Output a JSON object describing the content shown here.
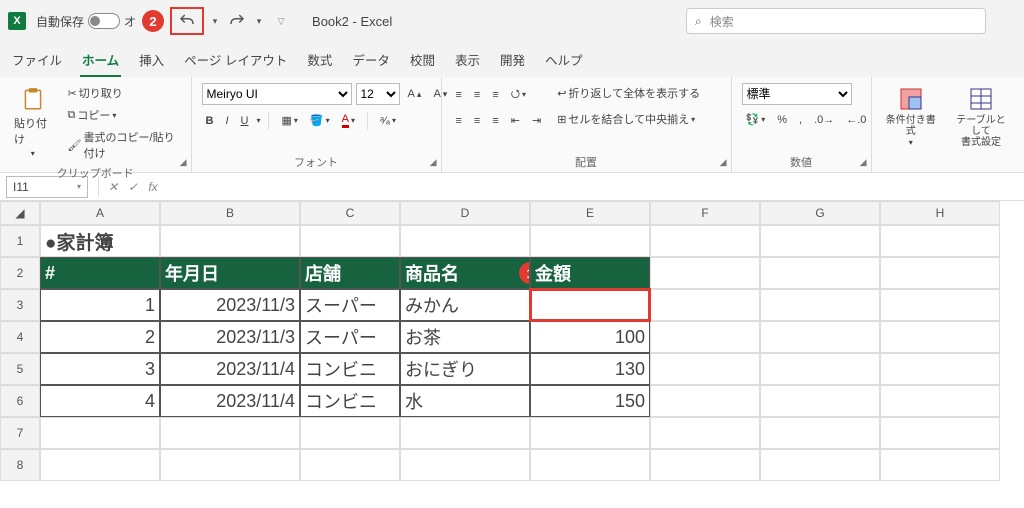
{
  "title": {
    "autosave_label": "自動保存",
    "autosave_state": "オ",
    "document": "Book2 - Excel",
    "search_placeholder": "検索"
  },
  "annot": {
    "m1": "1",
    "m2": "2"
  },
  "tabs": {
    "file": "ファイル",
    "home": "ホーム",
    "insert": "挿入",
    "layout": "ページ レイアウト",
    "formulas": "数式",
    "data": "データ",
    "review": "校閲",
    "view": "表示",
    "dev": "開発",
    "help": "ヘルプ"
  },
  "ribbon": {
    "clipboard": {
      "paste": "貼り付け",
      "cut": "切り取り",
      "copy": "コピー",
      "painter": "書式のコピー/貼り付け",
      "label": "クリップボード"
    },
    "font": {
      "name": "Meiryo UI",
      "size": "12",
      "label": "フォント"
    },
    "align": {
      "wrap": "折り返して全体を表示する",
      "merge": "セルを結合して中央揃え",
      "label": "配置"
    },
    "number": {
      "std": "標準",
      "label": "数値"
    },
    "styles": {
      "cond": "条件付き書式",
      "tbl_l1": "テーブルとして",
      "tbl_l2": "書式設定"
    }
  },
  "formula": {
    "name_box": "I11",
    "fx": "fx"
  },
  "cols": {
    "A": "A",
    "B": "B",
    "C": "C",
    "D": "D",
    "E": "E",
    "F": "F",
    "G": "G",
    "H": "H"
  },
  "rows": {
    "r1": "1",
    "r2": "2",
    "r3": "3",
    "r4": "4",
    "r5": "5",
    "r6": "6",
    "r7": "7",
    "r8": "8"
  },
  "sheet": {
    "title": "●家計簿",
    "h": {
      "num": "#",
      "date": "年月日",
      "shop": "店舗",
      "item": "商品名",
      "amt": "金額"
    },
    "d": [
      {
        "n": "1",
        "date": "2023/11/3",
        "shop": "スーパー",
        "item": "みかん",
        "amt": ""
      },
      {
        "n": "2",
        "date": "2023/11/3",
        "shop": "スーパー",
        "item": "お茶",
        "amt": "100"
      },
      {
        "n": "3",
        "date": "2023/11/4",
        "shop": "コンビニ",
        "item": "おにぎり",
        "amt": "130"
      },
      {
        "n": "4",
        "date": "2023/11/4",
        "shop": "コンビニ",
        "item": "水",
        "amt": "150"
      }
    ]
  }
}
